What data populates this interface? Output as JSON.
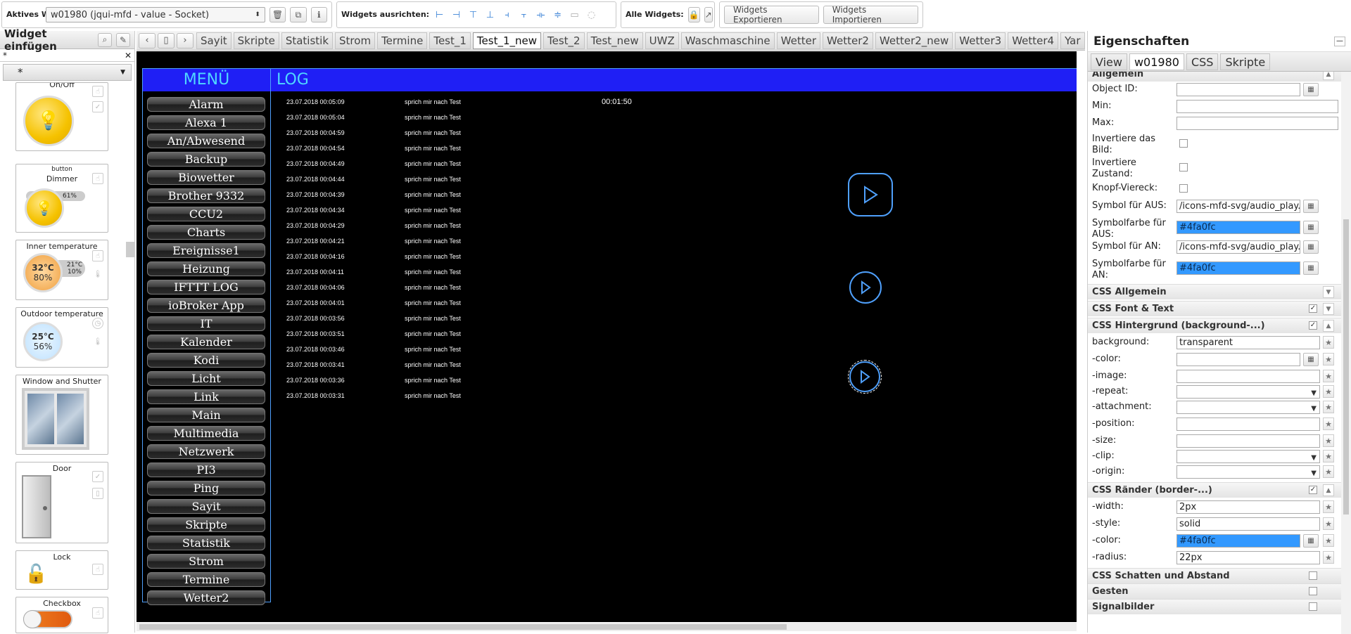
{
  "toolbar": {
    "active_widget_label": "Aktives Widget:",
    "active_widget_value": "w01980 (jqui-mfd - value - Socket)",
    "align_label": "Widgets ausrichten:",
    "all_widgets_label": "Alle Widgets:",
    "export_label": "Widgets Exportieren",
    "import_label": "Widgets Importieren"
  },
  "palette": {
    "title": "Widget einfügen",
    "filter_value": "*",
    "set_value": "*",
    "cards": [
      {
        "caption": "On/Off"
      },
      {
        "caption": "button",
        "sub": "Dimmer",
        "percent": "61%"
      },
      {
        "caption": "Inner temperature",
        "temp": "32°C",
        "hum": "80%",
        "t2": "21°C",
        "h2": "10%"
      },
      {
        "caption": "Outdoor temperature",
        "temp": "25°C",
        "hum": "56%"
      },
      {
        "caption": "Window and Shutter"
      },
      {
        "caption": "Door"
      },
      {
        "caption": "Lock"
      },
      {
        "caption": "Checkbox"
      }
    ]
  },
  "tabs": {
    "items": [
      "Sayit",
      "Skripte",
      "Statistik",
      "Strom",
      "Termine",
      "Test_1",
      "Test_1_new",
      "Test_2",
      "Test_new",
      "UWZ",
      "Waschmaschine",
      "Wetter",
      "Wetter2",
      "Wetter2_new",
      "Wetter3",
      "Wetter4",
      "Yar"
    ],
    "active": "Test_1_new"
  },
  "view": {
    "menu_title": "MENÜ",
    "log_title": "LOG",
    "timer": "00:01:50",
    "menu_items": [
      "Alarm",
      "Alexa 1",
      "An/Abwesend",
      "Backup",
      "Biowetter",
      "Brother 9332",
      "CCU2",
      "Charts",
      "Ereignisse1",
      "Heizung",
      "IFTTT LOG",
      "ioBroker App",
      "IT",
      "Kalender",
      "Kodi",
      "Licht",
      "Link",
      "Main",
      "Multimedia",
      "Netzwerk",
      "PI3",
      "Ping",
      "Sayit",
      "Skripte",
      "Statistik",
      "Strom",
      "Termine",
      "Wetter2"
    ],
    "log_entries": [
      {
        "time": "23.07.2018 00:05:09",
        "msg": "sprich mir nach Test"
      },
      {
        "time": "23.07.2018 00:05:04",
        "msg": "sprich mir nach Test"
      },
      {
        "time": "23.07.2018 00:04:59",
        "msg": "sprich mir nach Test"
      },
      {
        "time": "23.07.2018 00:04:54",
        "msg": "sprich mir nach Test"
      },
      {
        "time": "23.07.2018 00:04:49",
        "msg": "sprich mir nach Test"
      },
      {
        "time": "23.07.2018 00:04:44",
        "msg": "sprich mir nach Test"
      },
      {
        "time": "23.07.2018 00:04:39",
        "msg": "sprich mir nach Test"
      },
      {
        "time": "23.07.2018 00:04:34",
        "msg": "sprich mir nach Test"
      },
      {
        "time": "23.07.2018 00:04:29",
        "msg": "sprich mir nach Test"
      },
      {
        "time": "23.07.2018 00:04:21",
        "msg": "sprich mir nach Test"
      },
      {
        "time": "23.07.2018 00:04:16",
        "msg": "sprich mir nach Test"
      },
      {
        "time": "23.07.2018 00:04:11",
        "msg": "sprich mir nach Test"
      },
      {
        "time": "23.07.2018 00:04:06",
        "msg": "sprich mir nach Test"
      },
      {
        "time": "23.07.2018 00:04:01",
        "msg": "sprich mir nach Test"
      },
      {
        "time": "23.07.2018 00:03:56",
        "msg": "sprich mir nach Test"
      },
      {
        "time": "23.07.2018 00:03:51",
        "msg": "sprich mir nach Test"
      },
      {
        "time": "23.07.2018 00:03:46",
        "msg": "sprich mir nach Test"
      },
      {
        "time": "23.07.2018 00:03:41",
        "msg": "sprich mir nach Test"
      },
      {
        "time": "23.07.2018 00:03:36",
        "msg": "sprich mir nach Test"
      },
      {
        "time": "23.07.2018 00:03:31",
        "msg": "sprich mir nach Test"
      }
    ],
    "accent_color": "#4fa0fc"
  },
  "props": {
    "title": "Eigenschaften",
    "tabs": [
      "View",
      "w01980",
      "CSS",
      "Skripte"
    ],
    "active_tab": "w01980",
    "section_general": "Allgemein",
    "object_id_label": "Object ID:",
    "min_label": "Min:",
    "max_label": "Max:",
    "invert_image_label": "Invertiere das Bild:",
    "invert_state_label": "Invertiere Zustand:",
    "button_square_label": "Knopf-Viereck:",
    "symbol_off_label": "Symbol für AUS:",
    "symbol_off_value": "/icons-mfd-svg/audio_play.svg",
    "symbol_color_off_label": "Symbolfarbe für AUS:",
    "symbol_color_off_value": "#4fa0fc",
    "symbol_on_label": "Symbol für AN:",
    "symbol_on_value": "/icons-mfd-svg/audio_play.svg",
    "symbol_color_on_label": "Symbolfarbe für AN:",
    "symbol_color_on_value": "#4fa0fc",
    "css_general": "CSS Allgemein",
    "css_font": "CSS Font & Text",
    "css_background": "CSS Hintergrund (background-...)",
    "bg_label": "background:",
    "bg_value": "transparent",
    "bg_color_label": "-color:",
    "bg_image_label": "-image:",
    "bg_repeat_label": "-repeat:",
    "bg_attachment_label": "-attachment:",
    "bg_position_label": "-position:",
    "bg_size_label": "-size:",
    "bg_clip_label": "-clip:",
    "bg_origin_label": "-origin:",
    "css_border": "CSS Ränder (border-...)",
    "border_width_label": "-width:",
    "border_width_value": "2px",
    "border_style_label": "-style:",
    "border_style_value": "solid",
    "border_color_label": "-color:",
    "border_color_value": "#4fa0fc",
    "border_radius_label": "-radius:",
    "border_radius_value": "22px",
    "css_shadow": "CSS Schatten und Abstand",
    "gestures": "Gesten",
    "signal_images": "Signalbilder"
  }
}
